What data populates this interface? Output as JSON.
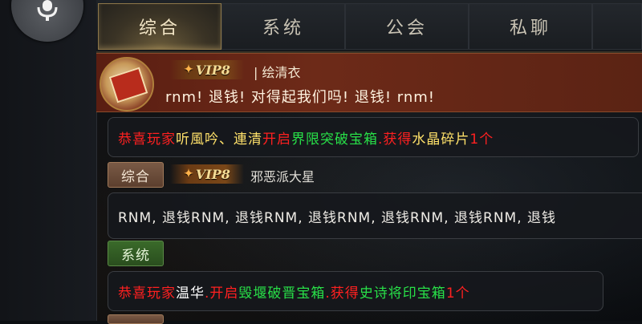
{
  "tabs": [
    {
      "label": "综合",
      "active": true
    },
    {
      "label": "系统",
      "active": false
    },
    {
      "label": "公会",
      "active": false
    },
    {
      "label": "私聊",
      "active": false
    }
  ],
  "messages": {
    "pinned": {
      "vip": "VIP8",
      "sender": "| 绘清衣",
      "text": "rnm! 退钱! 对得起我们吗! 退钱! rnm!"
    },
    "announcement1": {
      "parts": [
        {
          "text": "恭喜玩家",
          "color": "red"
        },
        {
          "text": "听風吟、連清",
          "color": "yellow"
        },
        {
          "text": "开启",
          "color": "red"
        },
        {
          "text": "界限突破宝箱",
          "color": "green"
        },
        {
          "text": ".获得",
          "color": "red"
        },
        {
          "text": "水晶碎片",
          "color": "yellow"
        },
        {
          "text": "1个",
          "color": "red"
        }
      ]
    },
    "chat1": {
      "channel": "综合",
      "vip": "VIP8",
      "sender": "邪恶派大星",
      "text": "RNM, 退钱RNM, 退钱RNM, 退钱RNM, 退钱RNM, 退钱RNM, 退钱"
    },
    "announcement2": {
      "channel": "系统",
      "parts": [
        {
          "text": "恭喜玩家",
          "color": "red"
        },
        {
          "text": "温华",
          "color": "white"
        },
        {
          "text": ".开启",
          "color": "red"
        },
        {
          "text": "毁堰破晋宝箱",
          "color": "green"
        },
        {
          "text": ".获得",
          "color": "red"
        },
        {
          "text": "史诗将印宝箱",
          "color": "green"
        },
        {
          "text": "1个",
          "color": "red"
        }
      ]
    }
  },
  "colors": {
    "red": "#ff2020",
    "green": "#28e048",
    "yellow": "#ffe16a",
    "white": "#ffffff",
    "vip_gold": "#f6dd96",
    "banner": "#6d2a18"
  },
  "icons": {
    "voice": "microphone-icon",
    "vip": "vip-badge-icon"
  }
}
